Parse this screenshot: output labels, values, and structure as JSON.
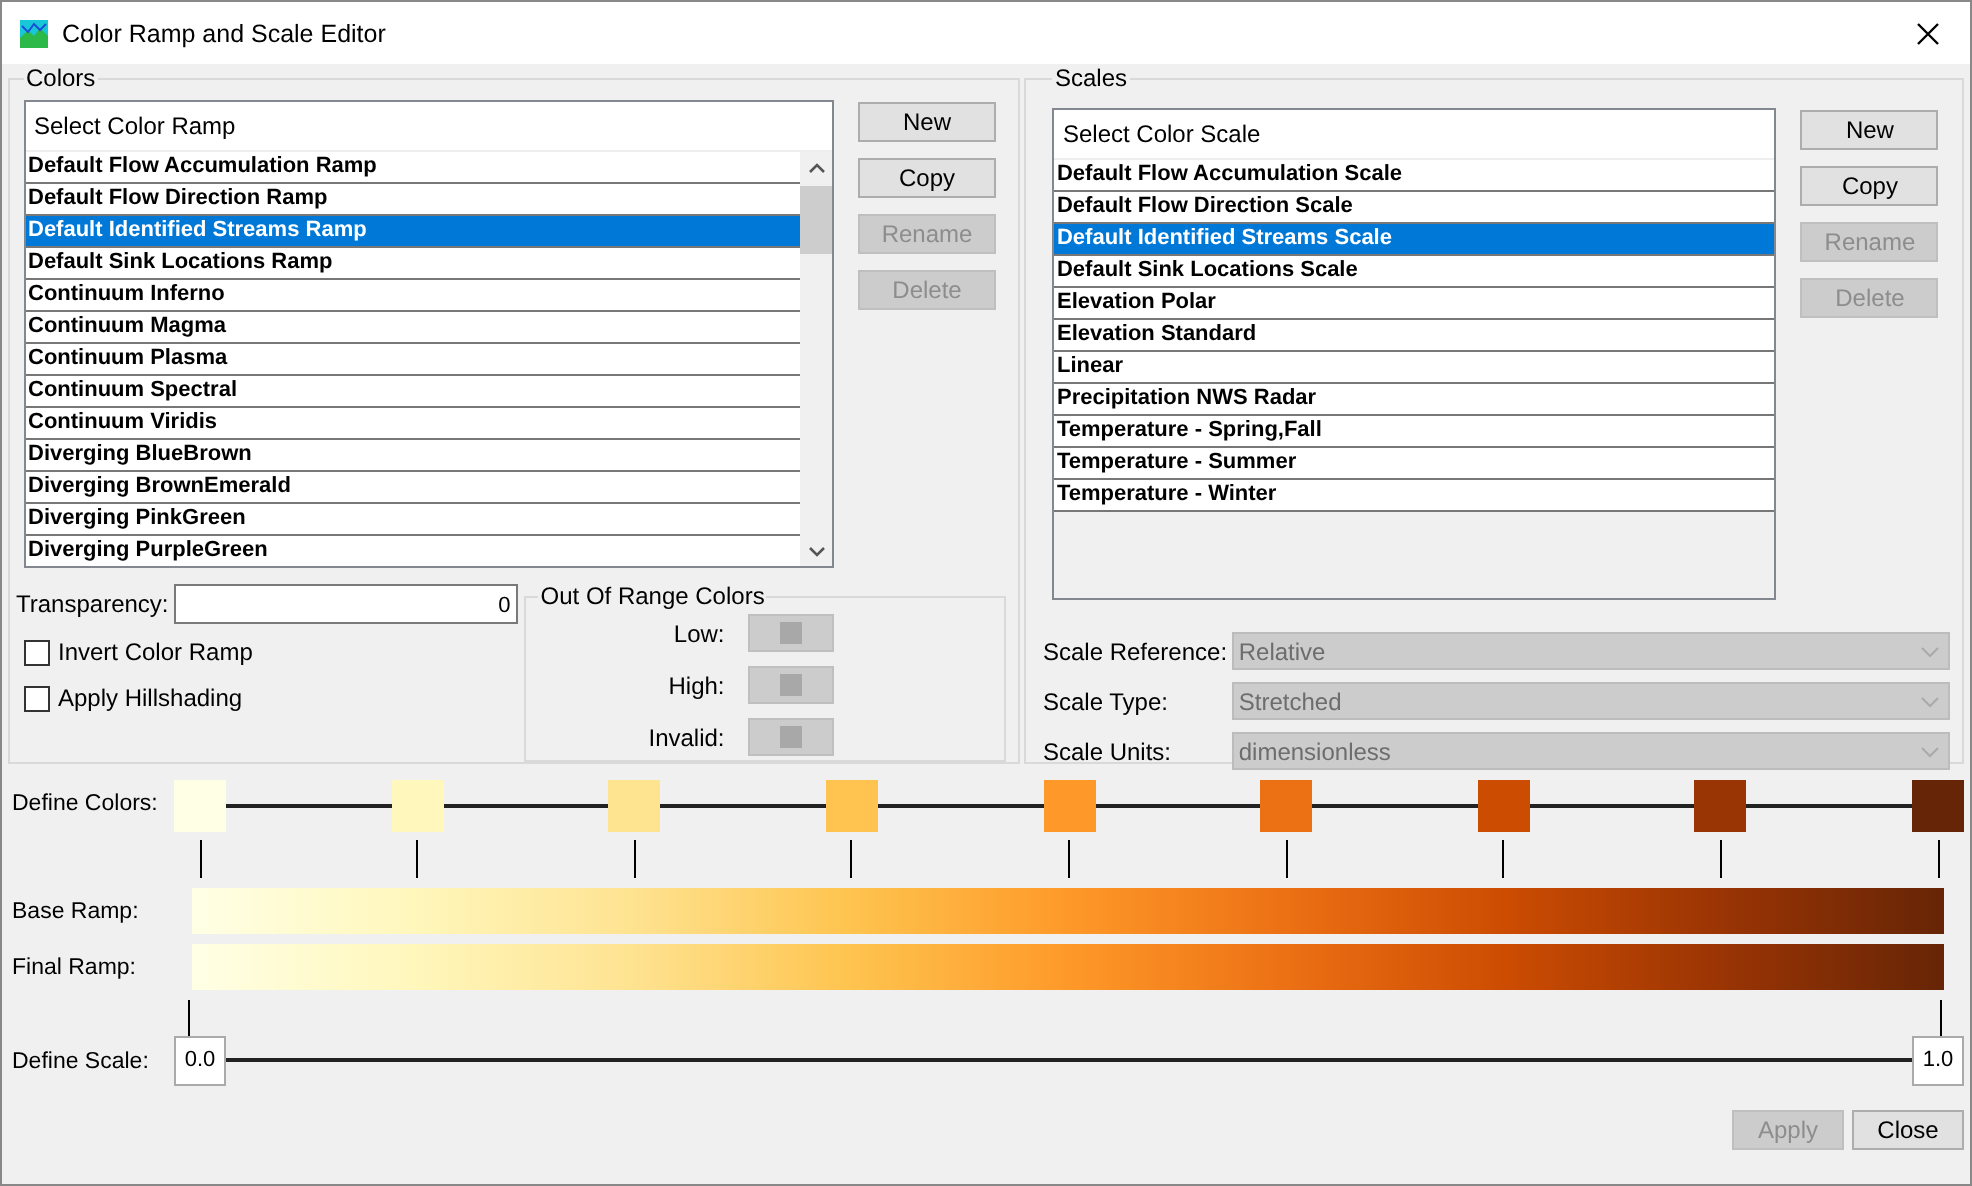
{
  "window": {
    "title": "Color Ramp and Scale Editor"
  },
  "colors": {
    "legend": "Colors",
    "list": {
      "header": "Select Color Ramp",
      "items": [
        {
          "label": "Default Flow Accumulation Ramp",
          "selected": false
        },
        {
          "label": "Default Flow Direction Ramp",
          "selected": false
        },
        {
          "label": "Default Identified Streams Ramp",
          "selected": true
        },
        {
          "label": "Default Sink Locations Ramp",
          "selected": false
        },
        {
          "label": "Continuum Inferno",
          "selected": false
        },
        {
          "label": "Continuum Magma",
          "selected": false
        },
        {
          "label": "Continuum Plasma",
          "selected": false
        },
        {
          "label": "Continuum Spectral",
          "selected": false
        },
        {
          "label": "Continuum Viridis",
          "selected": false
        },
        {
          "label": "Diverging BlueBrown",
          "selected": false
        },
        {
          "label": "Diverging BrownEmerald",
          "selected": false
        },
        {
          "label": "Diverging PinkGreen",
          "selected": false
        },
        {
          "label": "Diverging PurpleGreen",
          "selected": false
        }
      ]
    },
    "buttons": [
      {
        "label": "New",
        "disabled": false
      },
      {
        "label": "Copy",
        "disabled": false
      },
      {
        "label": "Rename",
        "disabled": true
      },
      {
        "label": "Delete",
        "disabled": true
      }
    ],
    "transparency": {
      "label": "Transparency:",
      "value": "0"
    },
    "checkboxes": [
      {
        "label": "Invert Color Ramp",
        "checked": false
      },
      {
        "label": "Apply Hillshading",
        "checked": false
      }
    ],
    "out_of_range": {
      "legend": "Out Of Range Colors",
      "items": [
        {
          "label": "Low:"
        },
        {
          "label": "High:"
        },
        {
          "label": "Invalid:"
        }
      ]
    }
  },
  "scales": {
    "legend": "Scales",
    "list": {
      "header": "Select Color Scale",
      "items": [
        {
          "label": "Default Flow Accumulation Scale",
          "selected": false
        },
        {
          "label": "Default Flow Direction Scale",
          "selected": false
        },
        {
          "label": "Default Identified Streams Scale",
          "selected": true
        },
        {
          "label": "Default Sink Locations Scale",
          "selected": false
        },
        {
          "label": "Elevation Polar",
          "selected": false
        },
        {
          "label": "Elevation Standard",
          "selected": false
        },
        {
          "label": "Linear",
          "selected": false
        },
        {
          "label": "Precipitation NWS Radar",
          "selected": false
        },
        {
          "label": "Temperature - Spring,Fall",
          "selected": false
        },
        {
          "label": "Temperature - Summer",
          "selected": false
        },
        {
          "label": "Temperature - Winter",
          "selected": false
        }
      ]
    },
    "buttons": [
      {
        "label": "New",
        "disabled": false
      },
      {
        "label": "Copy",
        "disabled": false
      },
      {
        "label": "Rename",
        "disabled": true
      },
      {
        "label": "Delete",
        "disabled": true
      }
    ],
    "fields": [
      {
        "label": "Scale Reference:",
        "value": "Relative",
        "disabled": true
      },
      {
        "label": "Scale Type:",
        "value": "Stretched",
        "disabled": true
      },
      {
        "label": "Scale Units:",
        "value": "dimensionless",
        "disabled": true
      }
    ]
  },
  "ramp_editor": {
    "define_colors_label": "Define Colors:",
    "stops": [
      {
        "color": "#ffffe5"
      },
      {
        "color": "#fff7bc"
      },
      {
        "color": "#fee391"
      },
      {
        "color": "#fec44f"
      },
      {
        "color": "#fe9929"
      },
      {
        "color": "#ec7014"
      },
      {
        "color": "#cc4c02"
      },
      {
        "color": "#993404"
      },
      {
        "color": "#662506"
      }
    ],
    "base_ramp_label": "Base Ramp:",
    "final_ramp_label": "Final Ramp:",
    "define_scale_label": "Define Scale:",
    "scale_min": "0.0",
    "scale_max": "1.0"
  },
  "footer_buttons": [
    {
      "label": "Apply",
      "disabled": true
    },
    {
      "label": "Close",
      "disabled": false
    }
  ]
}
